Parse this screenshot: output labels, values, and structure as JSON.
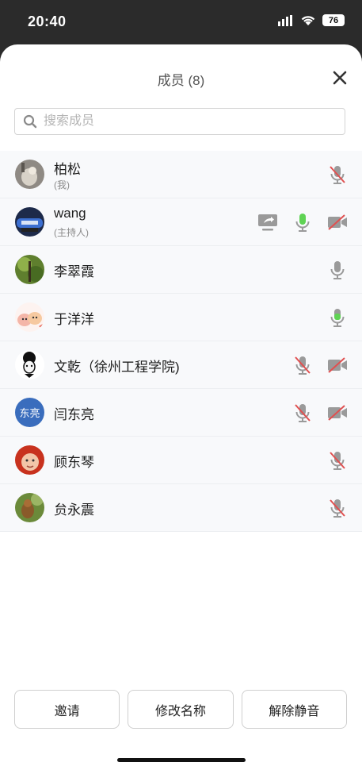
{
  "status_bar": {
    "time": "20:40",
    "battery": "76"
  },
  "sheet": {
    "title": "成员 (8)",
    "search_placeholder": "搜索成员"
  },
  "members": [
    {
      "name": "柏松",
      "subtitle": "(我)",
      "icons": [
        "mic-muted-icon"
      ]
    },
    {
      "name": "wang",
      "subtitle": "(主持人)",
      "icons": [
        "screen-share-icon",
        "mic-active-icon",
        "camera-off-icon"
      ]
    },
    {
      "name": "李翠霞",
      "icons": [
        "mic-icon"
      ]
    },
    {
      "name": "于洋洋",
      "icons": [
        "mic-active-icon"
      ]
    },
    {
      "name": "文乾（徐州工程学院)",
      "icons": [
        "mic-muted-icon",
        "camera-off-icon"
      ]
    },
    {
      "name": "闫东亮",
      "avatar_text": "东亮",
      "icons": [
        "mic-muted-icon",
        "camera-off-icon"
      ]
    },
    {
      "name": "顾东琴",
      "icons": [
        "mic-muted-icon"
      ]
    },
    {
      "name": "贠永震",
      "icons": [
        "mic-muted-icon"
      ]
    }
  ],
  "buttons": {
    "invite": "邀请",
    "rename": "修改名称",
    "unmute": "解除静音"
  },
  "colors": {
    "mic_active": "#5fd354",
    "muted_slash": "#e05050",
    "icon_gray": "#9a9a9a"
  }
}
